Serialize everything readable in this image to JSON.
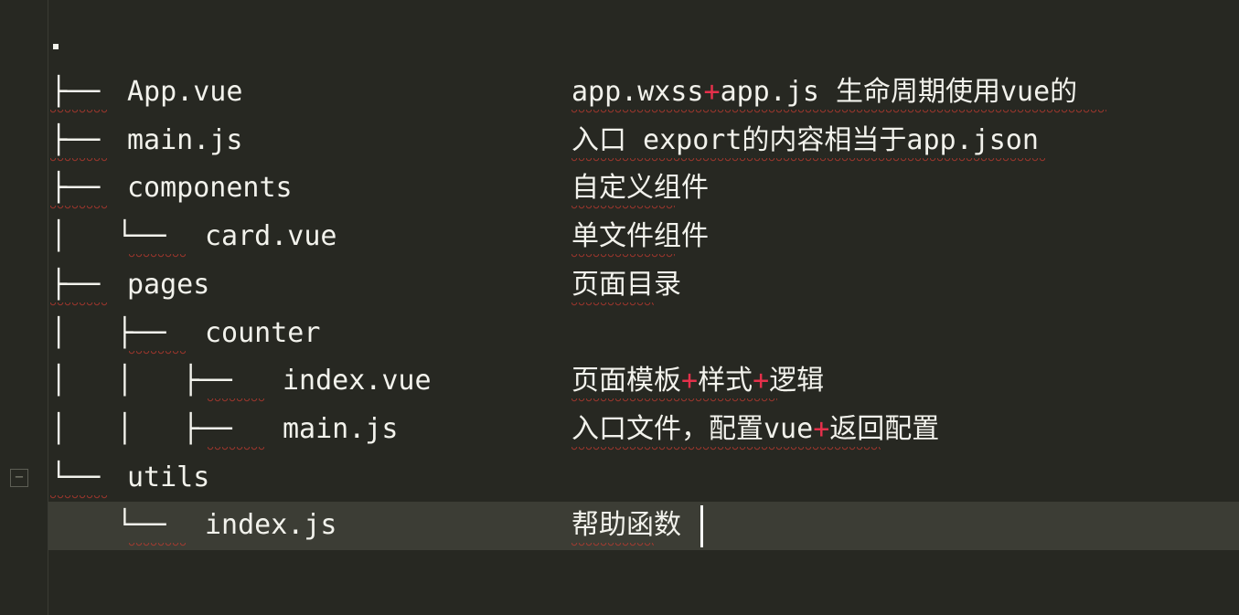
{
  "root_marker": ".",
  "rows": [
    {
      "tree": "├──",
      "name": "App.vue",
      "desc_parts": [
        {
          "t": "app.wxss",
          "plus": false
        },
        {
          "t": "+",
          "plus": true
        },
        {
          "t": "app.js 生命周期使用vue的",
          "plus": false
        }
      ]
    },
    {
      "tree": "├──",
      "name": "main.js",
      "desc_parts": [
        {
          "t": "入口 export的内容相当于app.json",
          "plus": false
        }
      ]
    },
    {
      "tree": "├──",
      "name": "components",
      "desc_parts": [
        {
          "t": "自定义组件",
          "plus": false
        }
      ]
    },
    {
      "tree": "│   └──",
      "name": "card.vue",
      "desc_parts": [
        {
          "t": "单文件组件",
          "plus": false
        }
      ]
    },
    {
      "tree": "├──",
      "name": "pages",
      "desc_parts": [
        {
          "t": "页面目录",
          "plus": false
        }
      ]
    },
    {
      "tree": "│   ├──",
      "name": "counter",
      "desc_parts": []
    },
    {
      "tree": "│   │   ├──",
      "name": "index.vue",
      "desc_parts": [
        {
          "t": "页面模板",
          "plus": false
        },
        {
          "t": "+",
          "plus": true
        },
        {
          "t": "样式",
          "plus": false
        },
        {
          "t": "+",
          "plus": true
        },
        {
          "t": "逻辑",
          "plus": false
        }
      ]
    },
    {
      "tree": "│   │   ├──",
      "name": "main.js",
      "desc_parts": [
        {
          "t": "入口文件，配置vue",
          "plus": false
        },
        {
          "t": "+",
          "plus": true
        },
        {
          "t": "返回配置",
          "plus": false
        }
      ]
    },
    {
      "tree": "└──",
      "name": "utils",
      "desc_parts": []
    },
    {
      "tree": "    └──",
      "name": "index.js",
      "desc_parts": [
        {
          "t": "帮助函数",
          "plus": false
        }
      ]
    }
  ],
  "colors": {
    "background": "#272822",
    "text": "#f2f2ec",
    "plus": "#e5304b",
    "squiggle": "#c23a2f",
    "cursor_line": "#3c3d35"
  },
  "icons": {
    "fold": "fold-minus-icon"
  }
}
